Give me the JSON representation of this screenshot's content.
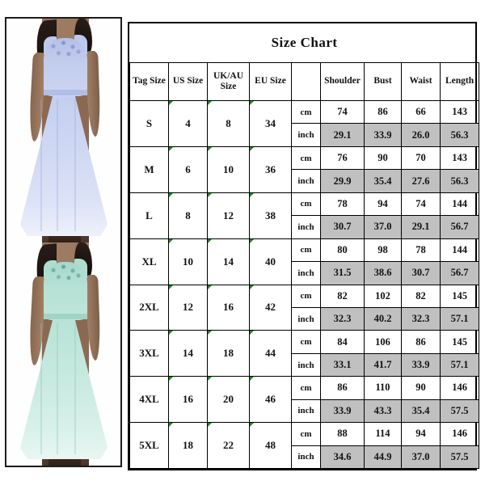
{
  "product_images": [
    {
      "id": "dress-lavender",
      "alt_label": "Lavender blue chiffon lace maxi dress",
      "color_hex": "#c8d2f0"
    },
    {
      "id": "dress-mint",
      "alt_label": "Mint green chiffon lace maxi dress",
      "color_hex": "#bfe5da"
    }
  ],
  "chart": {
    "title": "Size Chart",
    "columns": {
      "tag_size": "Tag Size",
      "us_size": "US Size",
      "uk_au_size": "UK/AU Size",
      "eu_size": "EU Size",
      "unit": "",
      "shoulder": "Shoulder",
      "bust": "Bust",
      "waist": "Waist",
      "length": "Length"
    },
    "units": {
      "cm": "cm",
      "inch": "inch"
    },
    "highlight_row_color": "#c0c0c0",
    "marker_color": "#1a8a1a",
    "rows": [
      {
        "tag_size": "S",
        "us_size": "4",
        "uk_au_size": "8",
        "eu_size": "34",
        "cm": {
          "shoulder": "74",
          "bust": "86",
          "waist": "66",
          "length": "143"
        },
        "inch": {
          "shoulder": "29.1",
          "bust": "33.9",
          "waist": "26.0",
          "length": "56.3"
        }
      },
      {
        "tag_size": "M",
        "us_size": "6",
        "uk_au_size": "10",
        "eu_size": "36",
        "cm": {
          "shoulder": "76",
          "bust": "90",
          "waist": "70",
          "length": "143"
        },
        "inch": {
          "shoulder": "29.9",
          "bust": "35.4",
          "waist": "27.6",
          "length": "56.3"
        }
      },
      {
        "tag_size": "L",
        "us_size": "8",
        "uk_au_size": "12",
        "eu_size": "38",
        "cm": {
          "shoulder": "78",
          "bust": "94",
          "waist": "74",
          "length": "144"
        },
        "inch": {
          "shoulder": "30.7",
          "bust": "37.0",
          "waist": "29.1",
          "length": "56.7"
        }
      },
      {
        "tag_size": "XL",
        "us_size": "10",
        "uk_au_size": "14",
        "eu_size": "40",
        "cm": {
          "shoulder": "80",
          "bust": "98",
          "waist": "78",
          "length": "144"
        },
        "inch": {
          "shoulder": "31.5",
          "bust": "38.6",
          "waist": "30.7",
          "length": "56.7"
        }
      },
      {
        "tag_size": "2XL",
        "us_size": "12",
        "uk_au_size": "16",
        "eu_size": "42",
        "cm": {
          "shoulder": "82",
          "bust": "102",
          "waist": "82",
          "length": "145"
        },
        "inch": {
          "shoulder": "32.3",
          "bust": "40.2",
          "waist": "32.3",
          "length": "57.1"
        }
      },
      {
        "tag_size": "3XL",
        "us_size": "14",
        "uk_au_size": "18",
        "eu_size": "44",
        "cm": {
          "shoulder": "84",
          "bust": "106",
          "waist": "86",
          "length": "145"
        },
        "inch": {
          "shoulder": "33.1",
          "bust": "41.7",
          "waist": "33.9",
          "length": "57.1"
        }
      },
      {
        "tag_size": "4XL",
        "us_size": "16",
        "uk_au_size": "20",
        "eu_size": "46",
        "cm": {
          "shoulder": "86",
          "bust": "110",
          "waist": "90",
          "length": "146"
        },
        "inch": {
          "shoulder": "33.9",
          "bust": "43.3",
          "waist": "35.4",
          "length": "57.5"
        }
      },
      {
        "tag_size": "5XL",
        "us_size": "18",
        "uk_au_size": "22",
        "eu_size": "48",
        "cm": {
          "shoulder": "88",
          "bust": "114",
          "waist": "94",
          "length": "146"
        },
        "inch": {
          "shoulder": "34.6",
          "bust": "44.9",
          "waist": "37.0",
          "length": "57.5"
        }
      }
    ]
  }
}
